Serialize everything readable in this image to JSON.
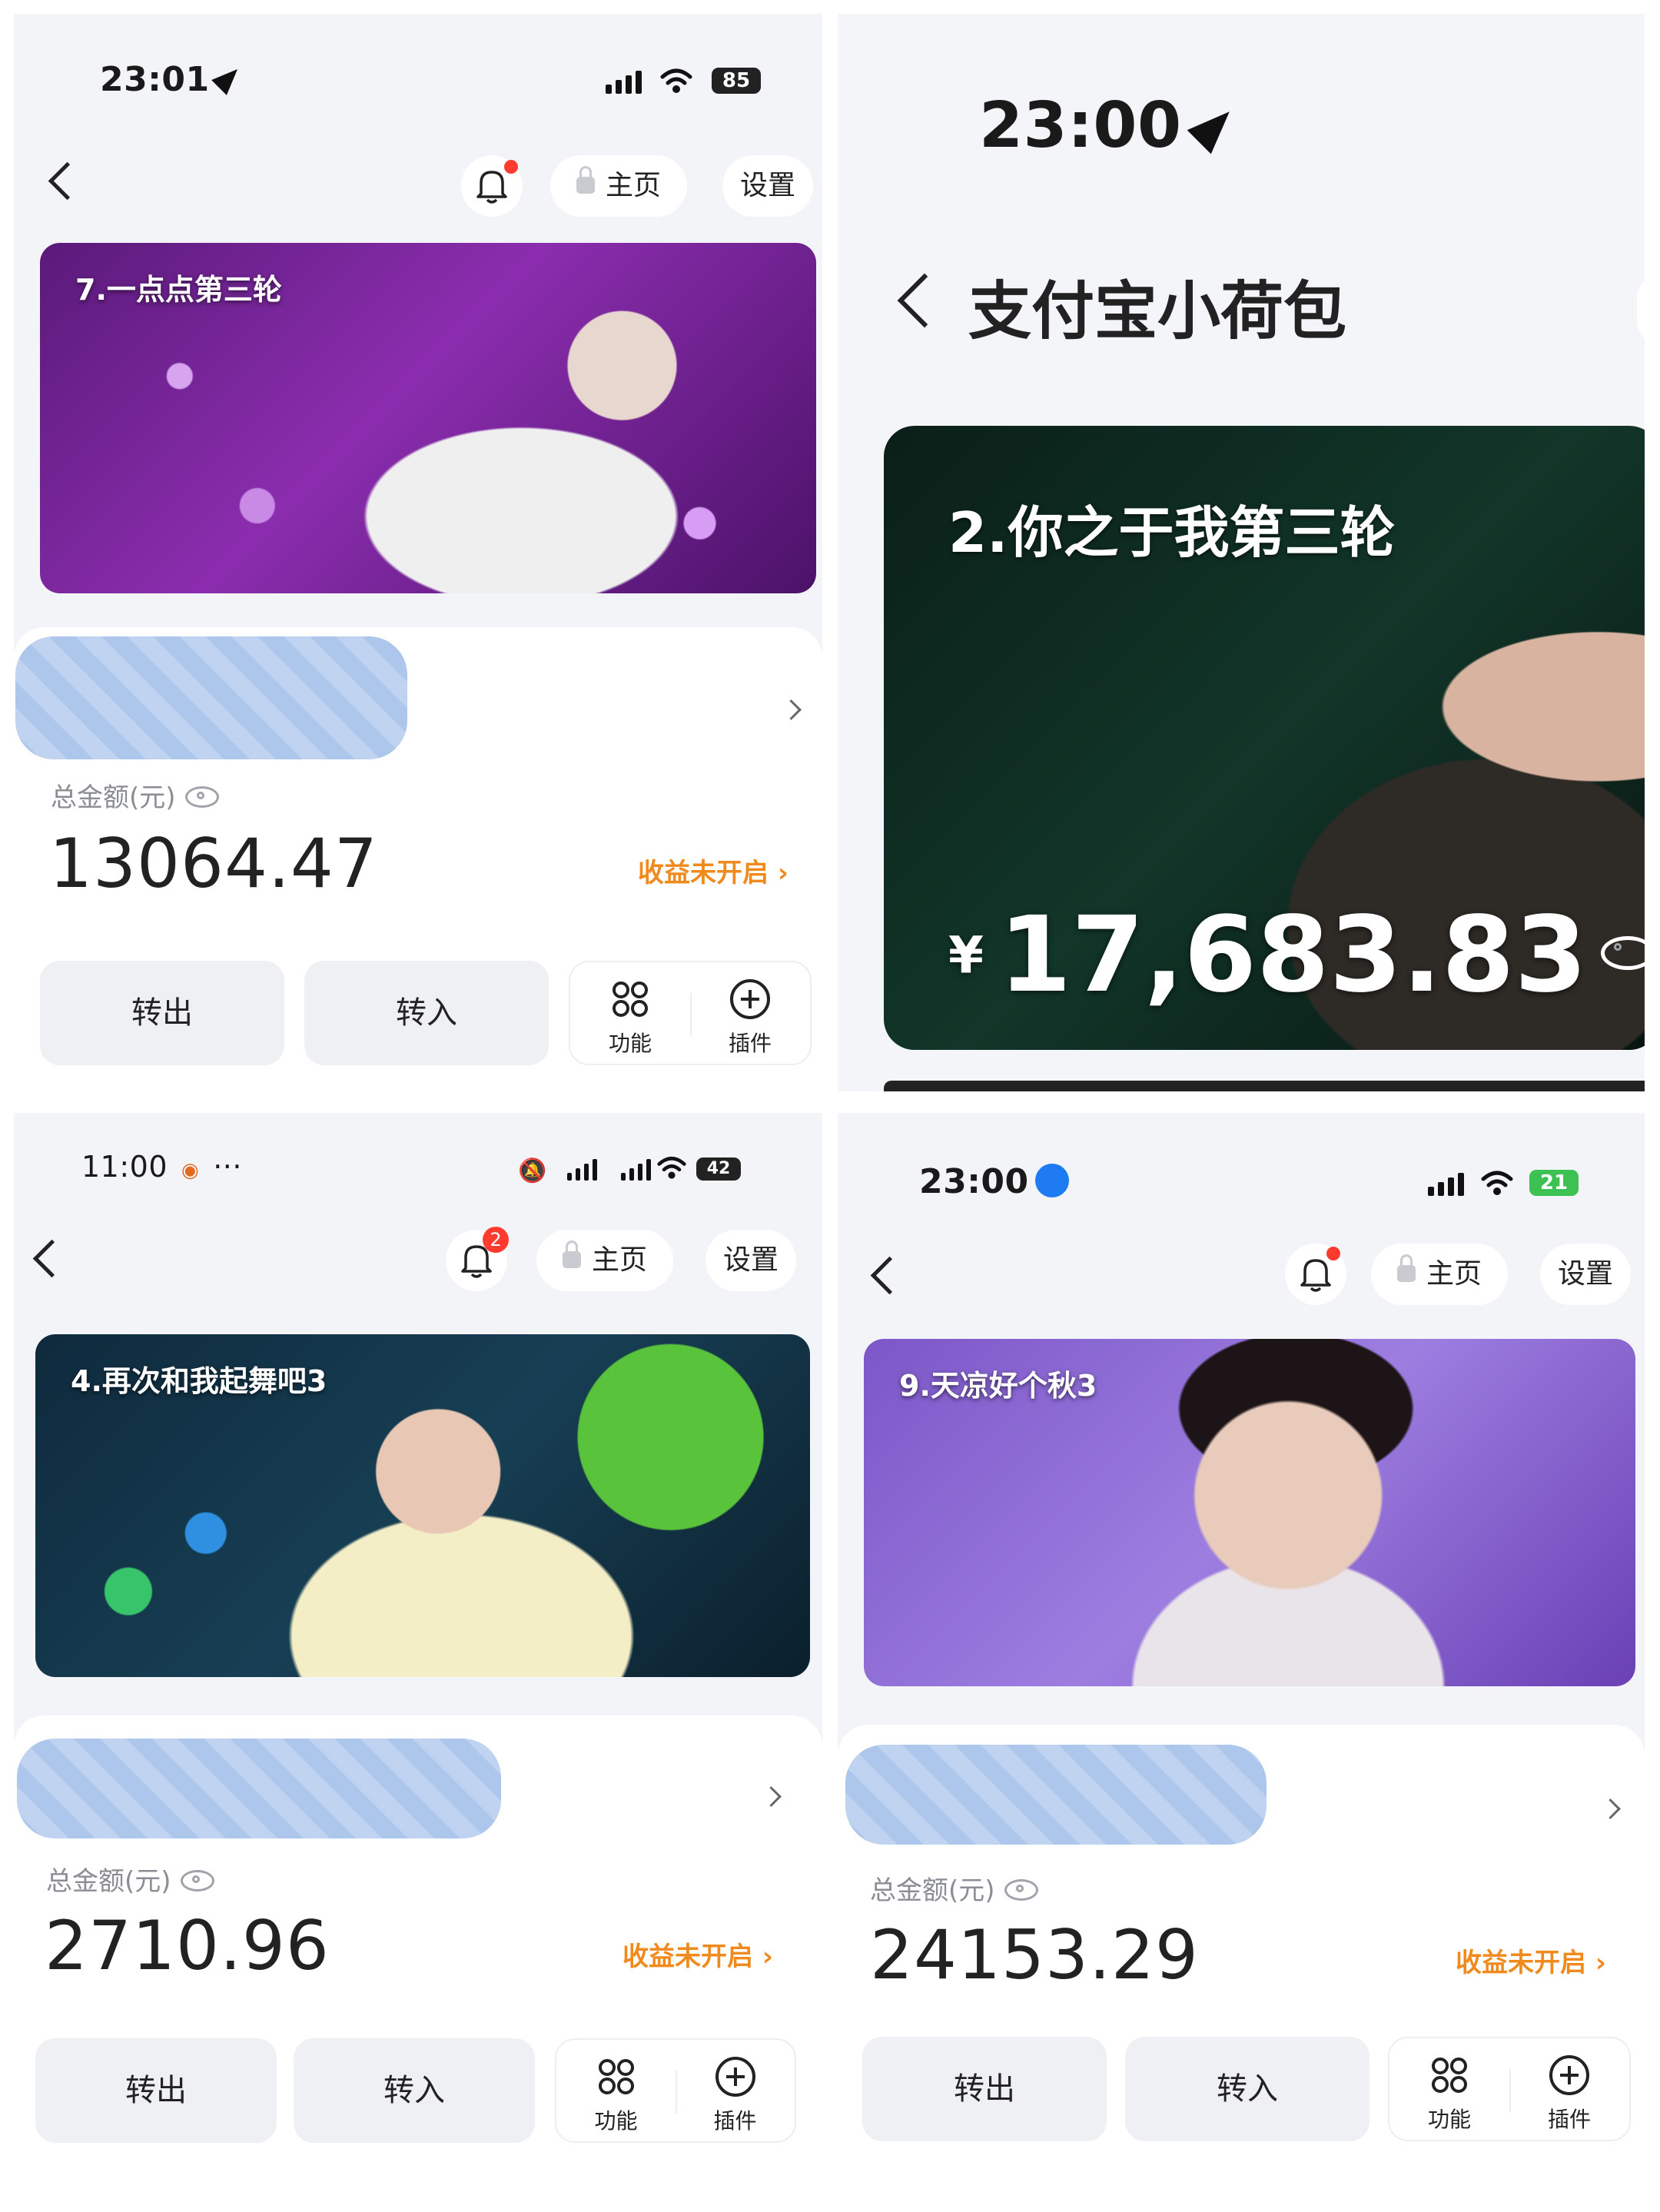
{
  "common": {
    "home_label": "主页",
    "settings_label": "设置",
    "total_label": "总金额(元)",
    "yield_label": "收益未开启",
    "transfer_out": "转出",
    "transfer_in": "转入",
    "functions_label": "功能",
    "plugins_label": "插件"
  },
  "panel1": {
    "time": "23:01",
    "battery": "85",
    "banner_title": "7.一点点第三轮",
    "amount": "13064.47"
  },
  "panel2": {
    "time": "23:00",
    "page_title": "支付宝小荷包",
    "banner_title": "2.你之于我第三轮",
    "currency": "¥",
    "amount": "17,683.83"
  },
  "panel3": {
    "time": "11:00",
    "battery": "42",
    "bell_badge": "2",
    "banner_title": "4.再次和我起舞吧3",
    "amount": "2710.96"
  },
  "panel4": {
    "time": "23:00",
    "battery": "21",
    "banner_title": "9.天凉好个秋3",
    "amount": "24153.29"
  }
}
